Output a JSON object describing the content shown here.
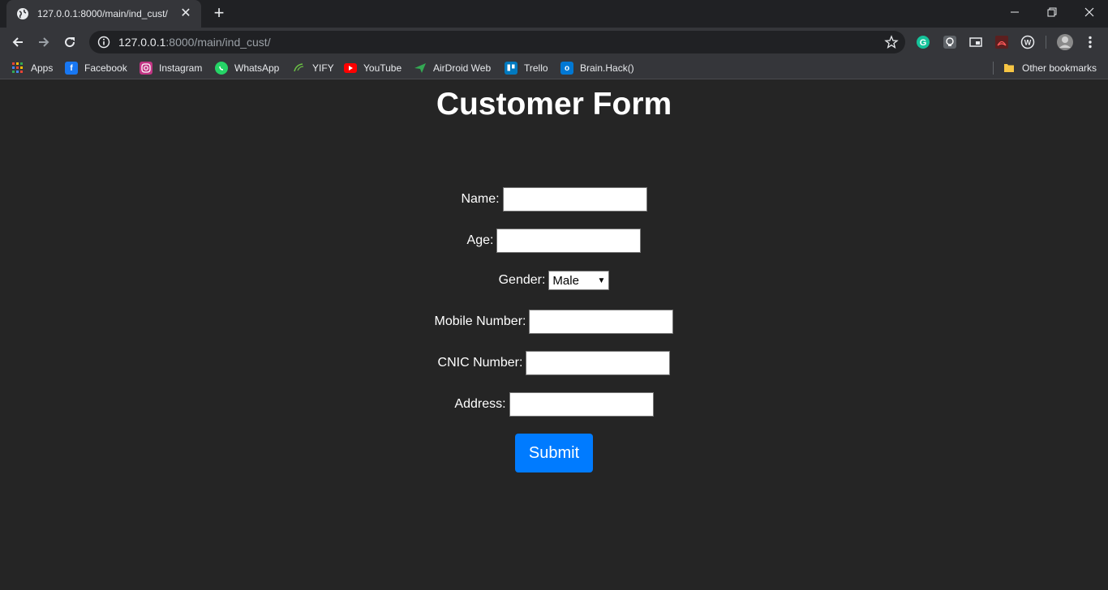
{
  "browser": {
    "tab_title": "127.0.0.1:8000/main/ind_cust/",
    "url_host": "127.0.0.1",
    "url_path": ":8000/main/ind_cust/",
    "bookmarks": [
      {
        "label": "Apps",
        "icon": "apps-grid-icon",
        "color": "#ea4335"
      },
      {
        "label": "Facebook",
        "icon": "facebook-icon",
        "color": "#1877f2"
      },
      {
        "label": "Instagram",
        "icon": "instagram-icon",
        "color": "#c13584"
      },
      {
        "label": "WhatsApp",
        "icon": "whatsapp-icon",
        "color": "#25d366"
      },
      {
        "label": "YIFY",
        "icon": "yify-icon",
        "color": "#6ac045"
      },
      {
        "label": "YouTube",
        "icon": "youtube-icon",
        "color": "#ff0000"
      },
      {
        "label": "AirDroid Web",
        "icon": "airdroid-icon",
        "color": "#34a853"
      },
      {
        "label": "Trello",
        "icon": "trello-icon",
        "color": "#0079bf"
      },
      {
        "label": "Brain.Hack()",
        "icon": "outlook-icon",
        "color": "#0078d4"
      }
    ],
    "other_bookmarks": "Other bookmarks"
  },
  "form": {
    "heading": "Customer Form",
    "name_label": "Name:",
    "age_label": "Age:",
    "gender_label": "Gender:",
    "gender_value": "Male",
    "mobile_label": "Mobile Number:",
    "cnic_label": "CNIC Number:",
    "address_label": "Address:",
    "submit_label": "Submit"
  },
  "colors": {
    "page_bg": "#252525",
    "submit_bg": "#007bff"
  }
}
